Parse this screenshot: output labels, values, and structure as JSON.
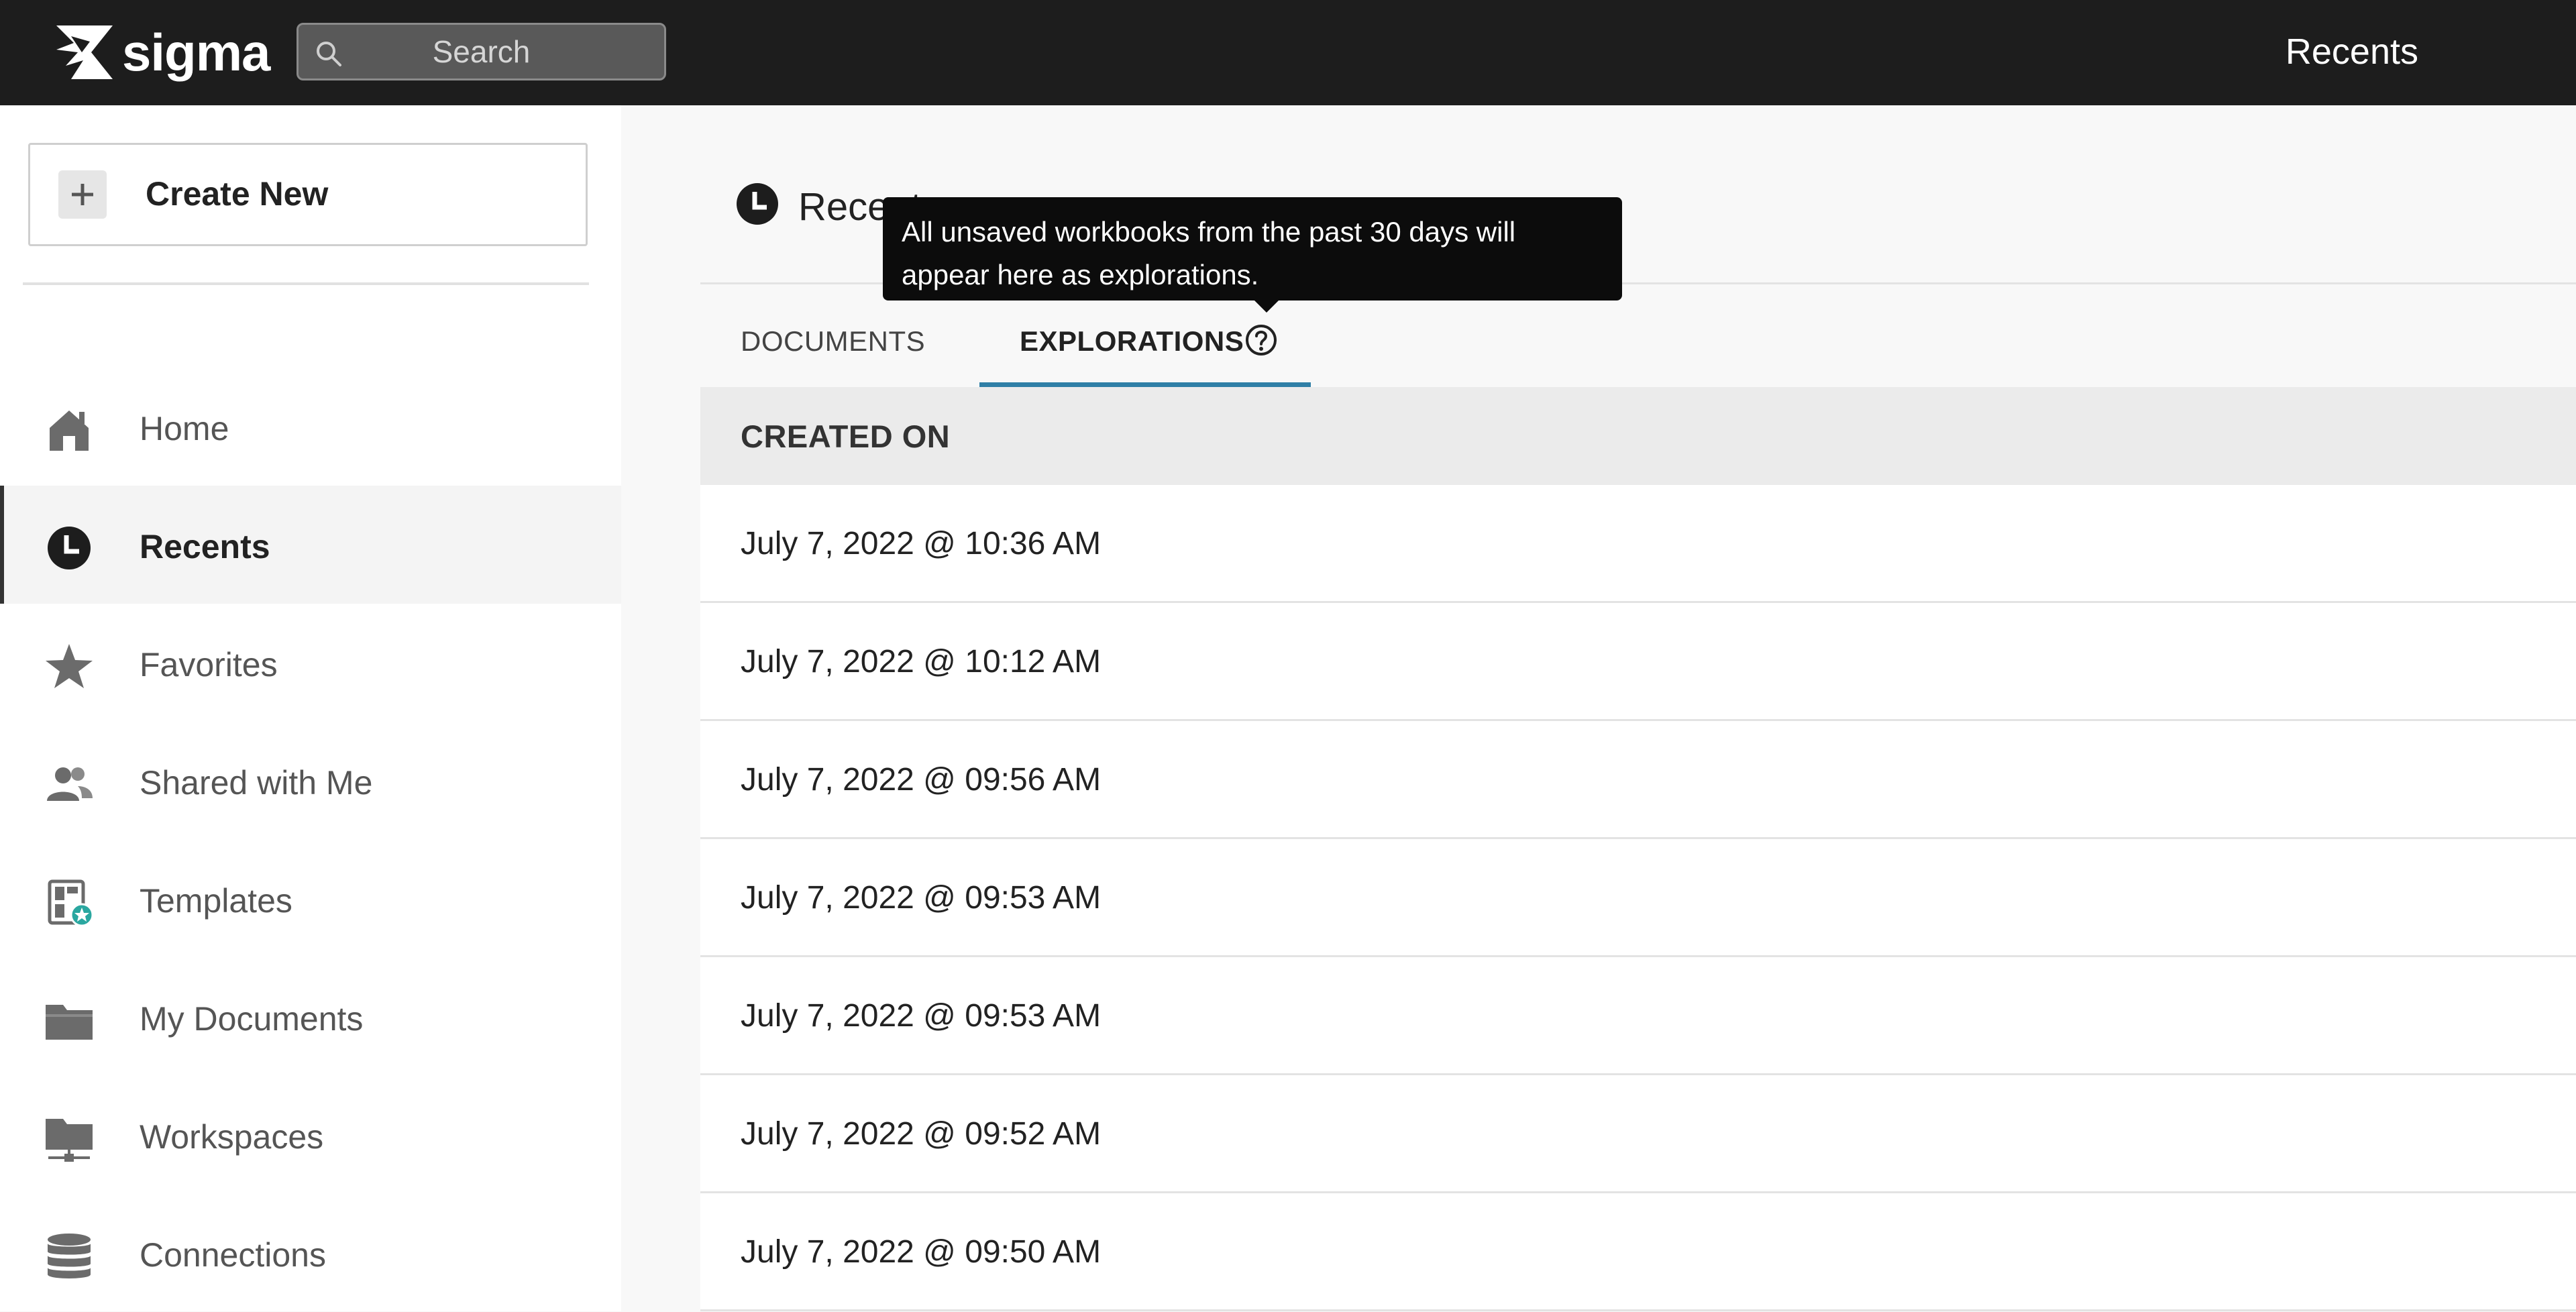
{
  "app": {
    "logo_text": "sigma",
    "search_placeholder": "Search",
    "top_title": "Recents"
  },
  "sidebar": {
    "create_new_label": "Create New",
    "items": [
      {
        "label": "Home",
        "icon": "home-icon"
      },
      {
        "label": "Recents",
        "icon": "clock-icon",
        "active": true
      },
      {
        "label": "Favorites",
        "icon": "star-icon"
      },
      {
        "label": "Shared with Me",
        "icon": "people-icon"
      },
      {
        "label": "Templates",
        "icon": "templates-icon"
      },
      {
        "label": "My Documents",
        "icon": "folder-icon"
      },
      {
        "label": "Workspaces",
        "icon": "workspace-folder-icon"
      },
      {
        "label": "Connections",
        "icon": "database-icon"
      }
    ]
  },
  "main": {
    "title": "Recents",
    "tabs": [
      {
        "label": "DOCUMENTS",
        "active": false
      },
      {
        "label": "EXPLORATIONS",
        "active": true
      }
    ],
    "tooltip": "All unsaved workbooks from the past 30 days will appear here as explorations.",
    "table": {
      "header": "CREATED ON",
      "rows": [
        "July 7, 2022 @ 10:36 AM",
        "July 7, 2022 @ 10:12 AM",
        "July 7, 2022 @ 09:56 AM",
        "July 7, 2022 @ 09:53 AM",
        "July 7, 2022 @ 09:53 AM",
        "July 7, 2022 @ 09:52 AM",
        "July 7, 2022 @ 09:50 AM"
      ]
    }
  },
  "colors": {
    "topbar": "#1d1d1d",
    "accent": "#2f7fa6",
    "template_badge": "#2aa7a0"
  }
}
